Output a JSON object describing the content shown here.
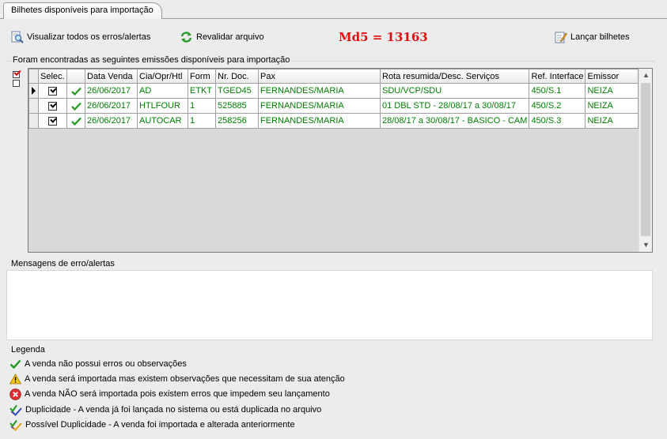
{
  "tab": {
    "label": "Bilhetes disponíveis para importação"
  },
  "toolbar": {
    "view_errors": "Visualizar todos os erros/alertas",
    "revalidate": "Revalidar arquivo",
    "md5": "Md5 = 13163",
    "launch": "Lançar bilhetes"
  },
  "group": {
    "label": "Foram encontradas as seguintes emissões disponíveis para importação"
  },
  "grid": {
    "columns": [
      "Selec.",
      "",
      "Data Venda",
      "Cia/Opr/Htl",
      "Form",
      "Nr. Doc.",
      "Pax",
      "Rota resumida/Desc. Serviços",
      "Ref. Interface",
      "Emissor"
    ],
    "rows": [
      {
        "date": "26/06/2017",
        "cia": "AD",
        "form": "ETKT",
        "doc": "TGED45",
        "pax": "FERNANDES/MARIA",
        "route": "SDU/VCP/SDU",
        "ref": "450/S.1",
        "emissor": "NEIZA"
      },
      {
        "date": "26/06/2017",
        "cia": "HTLFOUR",
        "form": "1",
        "doc": "525885",
        "pax": "FERNANDES/MARIA",
        "route": "01 DBL STD - 28/08/17 a 30/08/17",
        "ref": "450/S.2",
        "emissor": "NEIZA"
      },
      {
        "date": "26/06/2017",
        "cia": "AUTOCAR",
        "form": "1",
        "doc": "258256",
        "pax": "FERNANDES/MARIA",
        "route": "28/08/17 a 30/08/17 - BASICO - CAM",
        "ref": "450/S.3",
        "emissor": "NEIZA"
      }
    ]
  },
  "messages": {
    "label": "Mensagens de erro/alertas"
  },
  "legend": {
    "title": "Legenda",
    "items": [
      {
        "icon": "green-check-icon",
        "text": "A venda não possui erros ou observações"
      },
      {
        "icon": "warning-icon",
        "text": "A venda será importada mas existem observações que necessitam de sua atenção"
      },
      {
        "icon": "error-icon",
        "text": "A venda NÃO será importada pois existem erros que impedem seu lançamento"
      },
      {
        "icon": "duplicate-icon",
        "text": "Duplicidade - A venda já foi lançada no sistema ou está duplicada no arquivo"
      },
      {
        "icon": "possible-duplicate-icon",
        "text": "Possível Duplicidade - A venda foi importada e alterada anteriormente"
      }
    ]
  },
  "colors": {
    "ok_text": "#008000",
    "md5": "#e01010"
  }
}
